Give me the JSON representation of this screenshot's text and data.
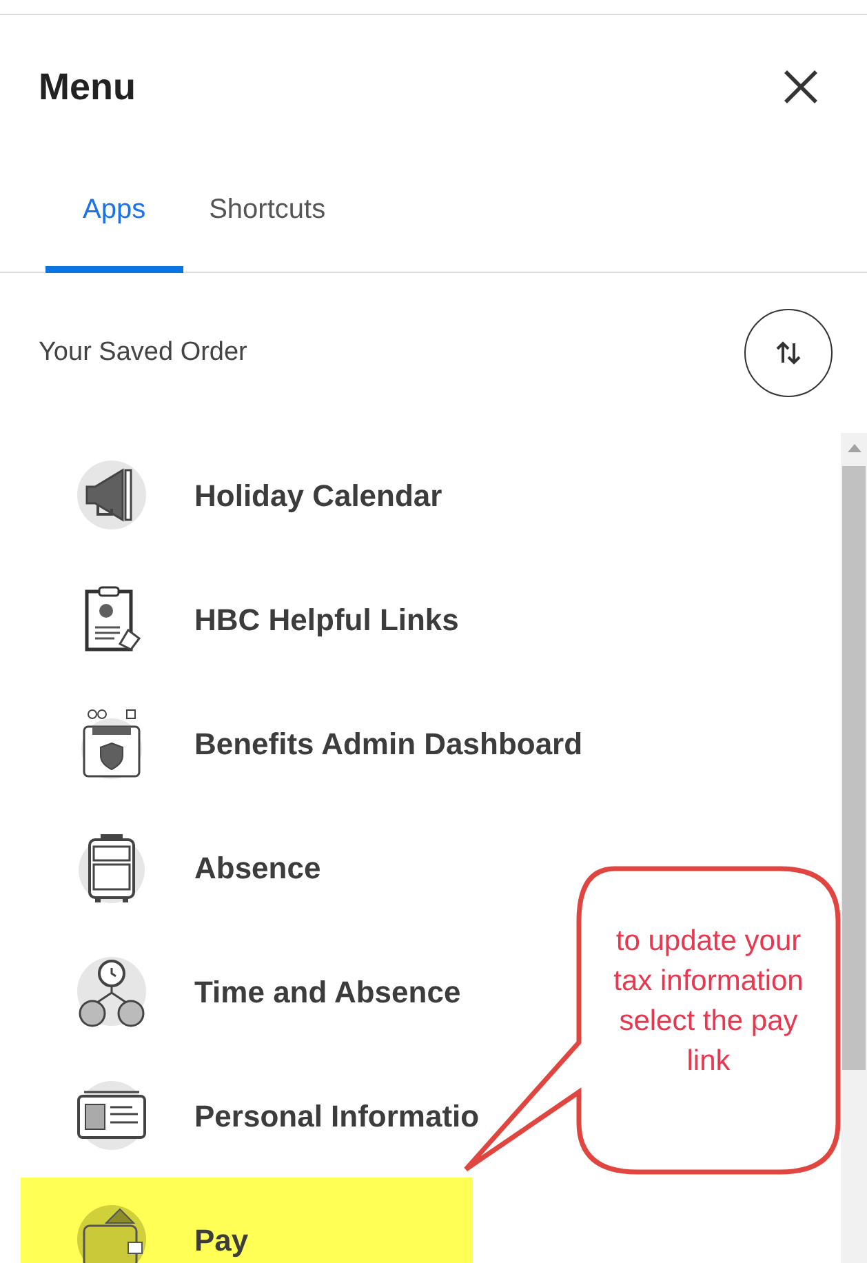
{
  "header": {
    "title": "Menu"
  },
  "tabs": [
    {
      "label": "Apps",
      "selected": true
    },
    {
      "label": "Shortcuts",
      "selected": false
    }
  ],
  "section": {
    "label": "Your Saved Order"
  },
  "apps": [
    {
      "label": "Holiday Calendar",
      "highlighted": false
    },
    {
      "label": "HBC Helpful Links",
      "highlighted": false
    },
    {
      "label": "Benefits Admin Dashboard",
      "highlighted": false
    },
    {
      "label": "Absence",
      "highlighted": false
    },
    {
      "label": "Time and Absence",
      "highlighted": false
    },
    {
      "label": "Personal Informatio",
      "highlighted": false
    },
    {
      "label": "Pay",
      "highlighted": true
    }
  ],
  "callout": {
    "text": "to update your tax information select the pay link"
  }
}
